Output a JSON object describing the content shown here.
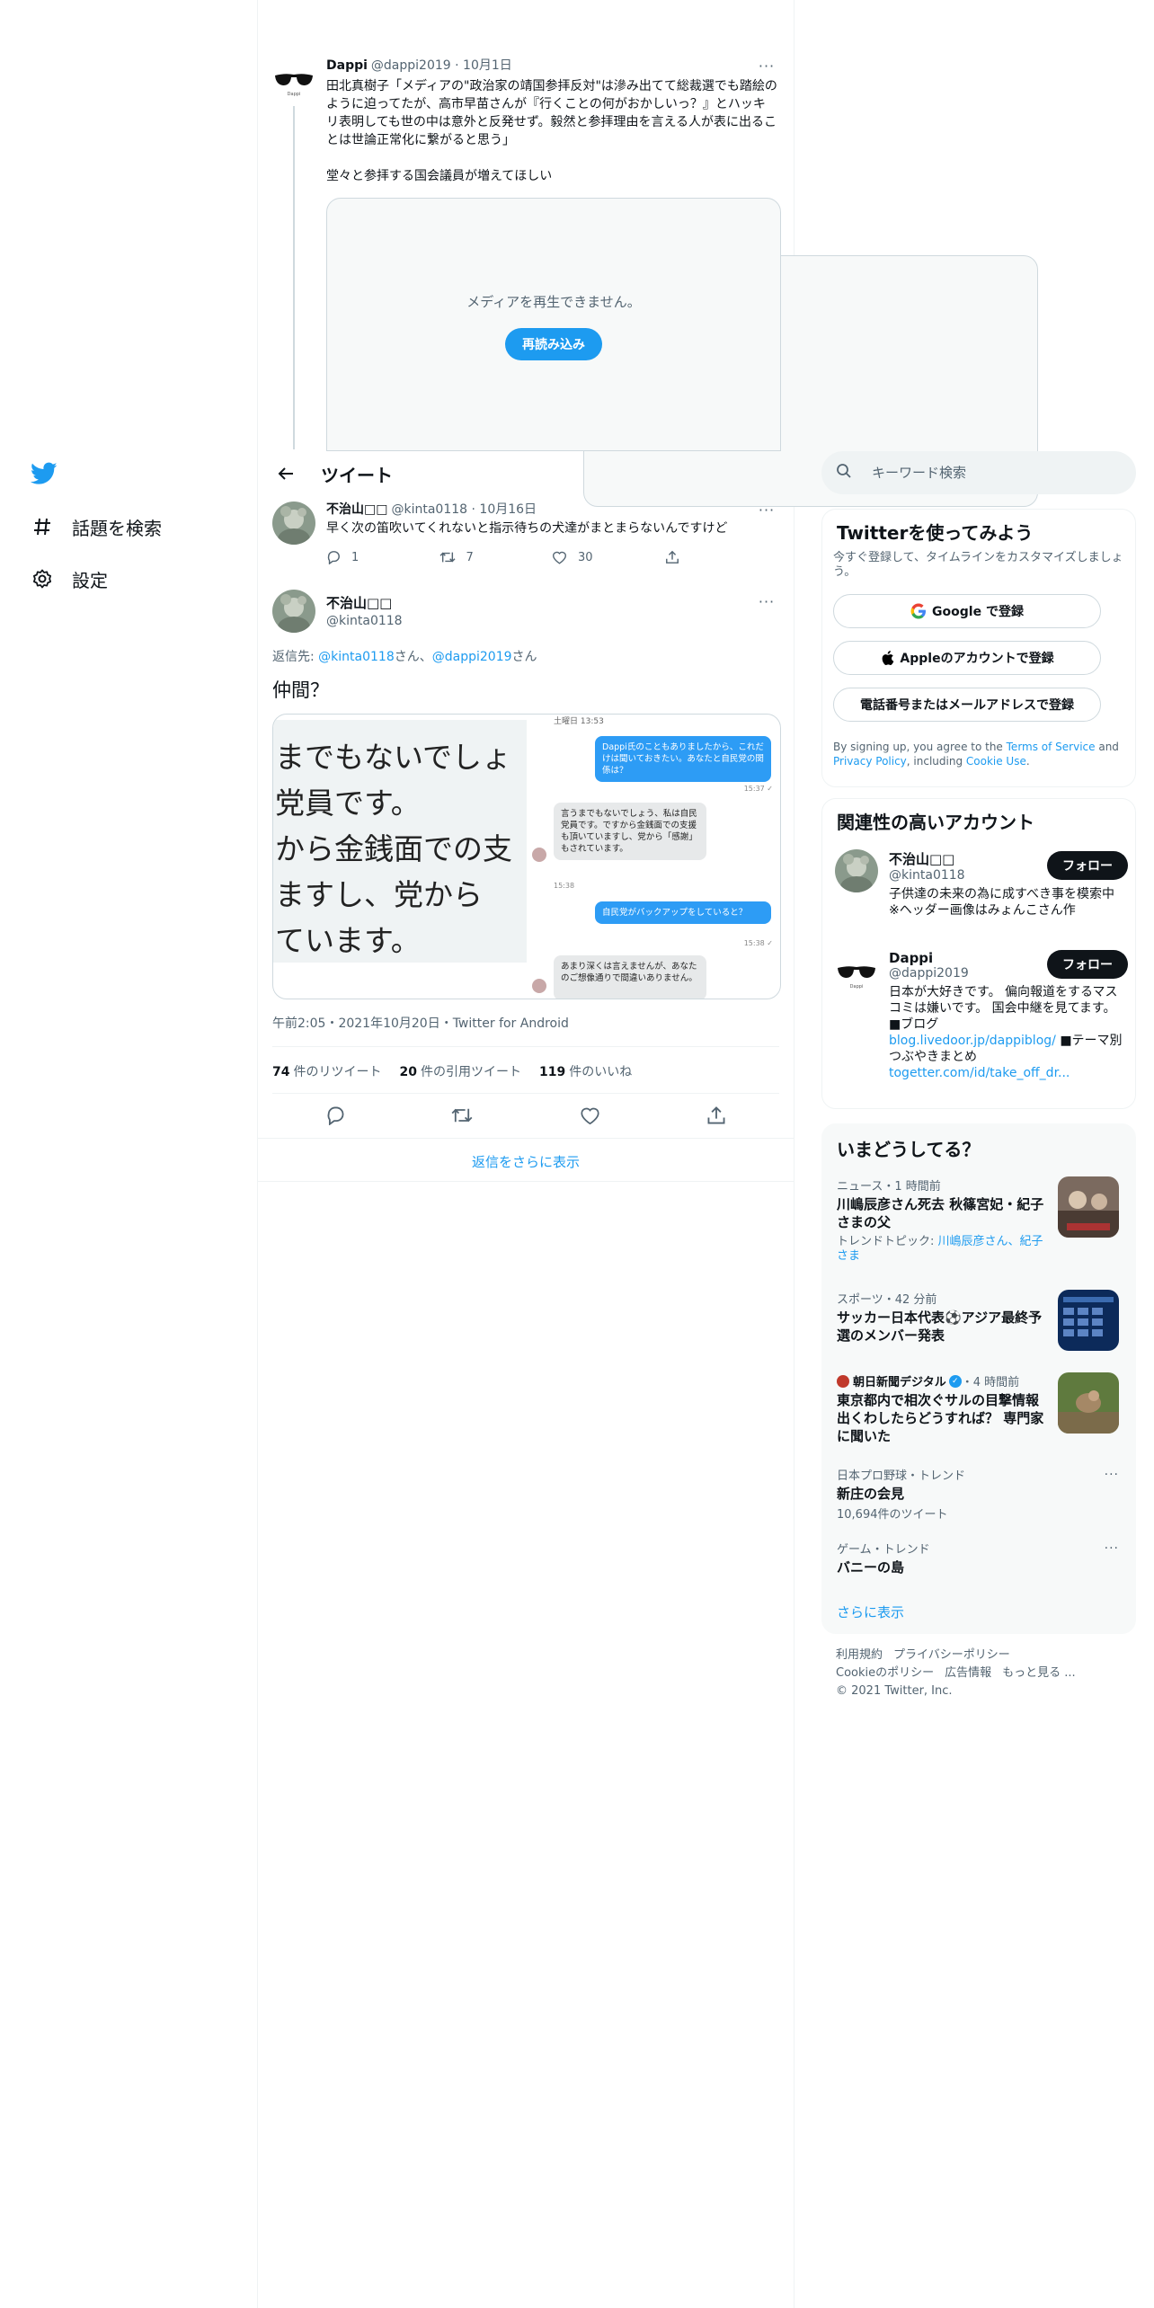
{
  "nav": {
    "items": [
      {
        "label": "話題を検索",
        "icon": "hashtag-icon"
      },
      {
        "label": "設定",
        "icon": "gear-icon"
      }
    ]
  },
  "top_tweet": {
    "name": "Dappi",
    "handle": "@dappi2019",
    "date": "10月1日",
    "text": "田北真樹子「メディアの\"政治家の靖国参拝反対\"は滲み出てて総裁選でも踏絵のように迫ってたが、高市早苗さんが『行くことの何がおかしいっ？』とハッキリ表明しても世の中は意外と反発せず。毅然と参拝理由を言える人が表に出ることは世論正常化に繋がると思う」\n\n堂々と参拝する国会議員が増えてほしい",
    "media_message": "メディアを再生できません。",
    "reload_label": "再読み込み"
  },
  "header": {
    "title": "ツイート"
  },
  "reply_tweet": {
    "name": "不治山□□",
    "handle": "@kinta0118",
    "date": "10月16日",
    "text": "早く次の笛吹いてくれないと指示待ちの犬達がまとまらないんですけど",
    "replies": "1",
    "retweets": "7",
    "likes": "30"
  },
  "main_tweet": {
    "name": "不治山□□",
    "handle": "@kinta0118",
    "reply_prefix": "返信先: ",
    "reply_to_1": "@kinta0118",
    "reply_suffix_1": "さん、",
    "reply_to_2": "@dappi2019",
    "reply_suffix_2": "さん",
    "text": "仲間？",
    "image": {
      "zoom_lines": [
        "までもないでしょ",
        "党員です。",
        "から金銭面での支",
        "ますし、党から",
        "ています。"
      ],
      "chat_date": "土曜日 13:53",
      "bubbles": [
        {
          "side": "right",
          "text": "Dappi氏のこともありましたから、これだけは聞いておきたい。あなたと自民党の関係は？",
          "time": "15:37 ✓"
        },
        {
          "side": "left",
          "text": "言うまでもないでしょう、私は自民党員です。ですから金銭面での支援も頂いていますし、党から「感謝」もされています。",
          "time": "15:38"
        },
        {
          "side": "right",
          "text": "自民党がバックアップをしていると？",
          "time": "15:38 ✓"
        },
        {
          "side": "left",
          "text": "あまり深くは言えませんが、あなたのご想像通りで間違いありません。",
          "time": ""
        }
      ]
    },
    "meta": "午前2:05・2021年10月20日・Twitter for Android",
    "retweets_count": "74",
    "retweets_label": "件のリツイート",
    "quotes_count": "20",
    "quotes_label": "件の引用ツイート",
    "likes_count": "119",
    "likes_label": "件のいいね"
  },
  "more_replies_label": "返信をさらに表示",
  "search": {
    "placeholder": "キーワード検索"
  },
  "signup": {
    "title": "Twitterを使ってみよう",
    "subtitle": "今すぐ登録して、タイムラインをカスタマイズしましょう。",
    "google_label": "Google で登録",
    "apple_label": "Appleのアカウントで登録",
    "phone_label": "電話番号またはメールアドレスで登録",
    "legal_prefix": "By signing up, you agree to the ",
    "legal_terms": "Terms of Service",
    "legal_and": " and ",
    "legal_privacy": "Privacy Policy",
    "legal_including": ", including ",
    "legal_cookie": "Cookie Use",
    "legal_end": "."
  },
  "related": {
    "title": "関連性の高いアカウント",
    "follow_label": "フォロー",
    "accounts": [
      {
        "name": "不治山□□",
        "handle": "@kinta0118",
        "bio": "子供達の未来の為に成すべき事を模索中 ※ヘッダー画像はみょんこさん作"
      },
      {
        "name": "Dappi",
        "handle": "@dappi2019",
        "bio": "日本が大好きです。 偏向報道をするマスコミは嫌いです。 国会中継を見てます。 ■ブログ",
        "link1": "blog.livedoor.jp/dappiblog/",
        "bio2": " ■テーマ別つぶやきまとめ",
        "link2": "togetter.com/id/take_off_dr..."
      }
    ]
  },
  "trends": {
    "title": "いまどうしてる？",
    "items": [
      {
        "context": "ニュース・1 時間前",
        "title": "川嶋辰彦さん死去 秋篠宮妃・紀子さまの父",
        "tags_label": "トレンドトピック: ",
        "tags": "川嶋辰彦さん、紀子さま"
      },
      {
        "context": "スポーツ・42 分前",
        "title": "サッカー日本代表⚽アジア最終予選のメンバー発表"
      },
      {
        "context_source": "朝日新聞デジタル",
        "context_time": "・4 時間前",
        "title": "東京都内で相次ぐサルの目撃情報 出くわしたらどうすれば？ 専門家に聞いた"
      },
      {
        "context": "日本プロ野球・トレンド",
        "title": "新庄の会見",
        "count": "10,694件のツイート"
      },
      {
        "context": "ゲーム・トレンド",
        "title": "バニーの島"
      }
    ],
    "show_more": "さらに表示"
  },
  "footer": {
    "terms": "利用規約",
    "privacy": "プライバシーポリシー",
    "cookie": "Cookieのポリシー",
    "ads": "広告情報",
    "more": "もっと見る ...",
    "copyright": "© 2021 Twitter, Inc."
  },
  "colors": {
    "accent": "#1d9bf0",
    "text": "#0f1419",
    "secondary": "#536471",
    "border": "#eff3f4"
  }
}
